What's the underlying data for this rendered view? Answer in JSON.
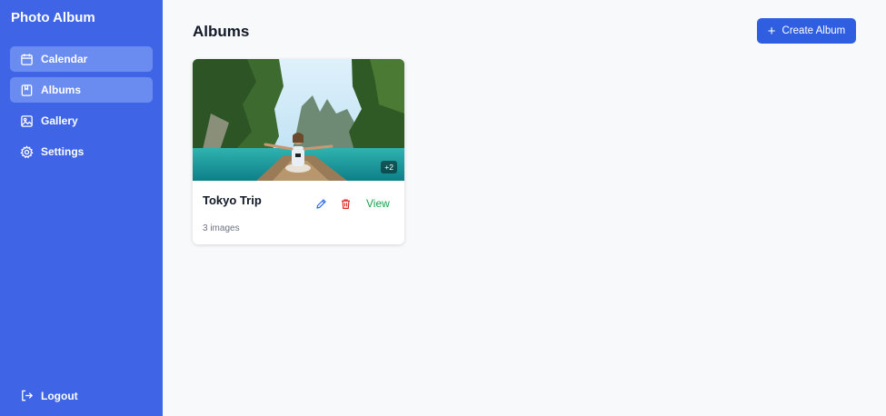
{
  "app": {
    "title": "Photo Album"
  },
  "sidebar": {
    "items": [
      {
        "label": "Calendar",
        "icon": "calendar-icon",
        "active": true
      },
      {
        "label": "Albums",
        "icon": "album-icon",
        "active": true
      },
      {
        "label": "Gallery",
        "icon": "image-icon",
        "active": false
      },
      {
        "label": "Settings",
        "icon": "gear-icon",
        "active": false
      }
    ],
    "logout_label": "Logout",
    "logout_icon": "logout-icon"
  },
  "main": {
    "title": "Albums",
    "create_button": {
      "label": "Create Album",
      "icon": "plus-icon"
    }
  },
  "albums": [
    {
      "title": "Tokyo Trip",
      "count_label": "3 images",
      "more_badge": "+2",
      "view_label": "View",
      "edit_icon": "pencil-icon",
      "delete_icon": "trash-icon"
    }
  ],
  "colors": {
    "sidebar_bg": "#3f64e5",
    "active_item_bg": "#6a8bf0",
    "primary_button": "#2f5fe0",
    "edit_icon": "#2563eb",
    "delete_icon": "#dc2626",
    "view_link": "#16a34a",
    "page_bg": "#f8f9fb"
  }
}
